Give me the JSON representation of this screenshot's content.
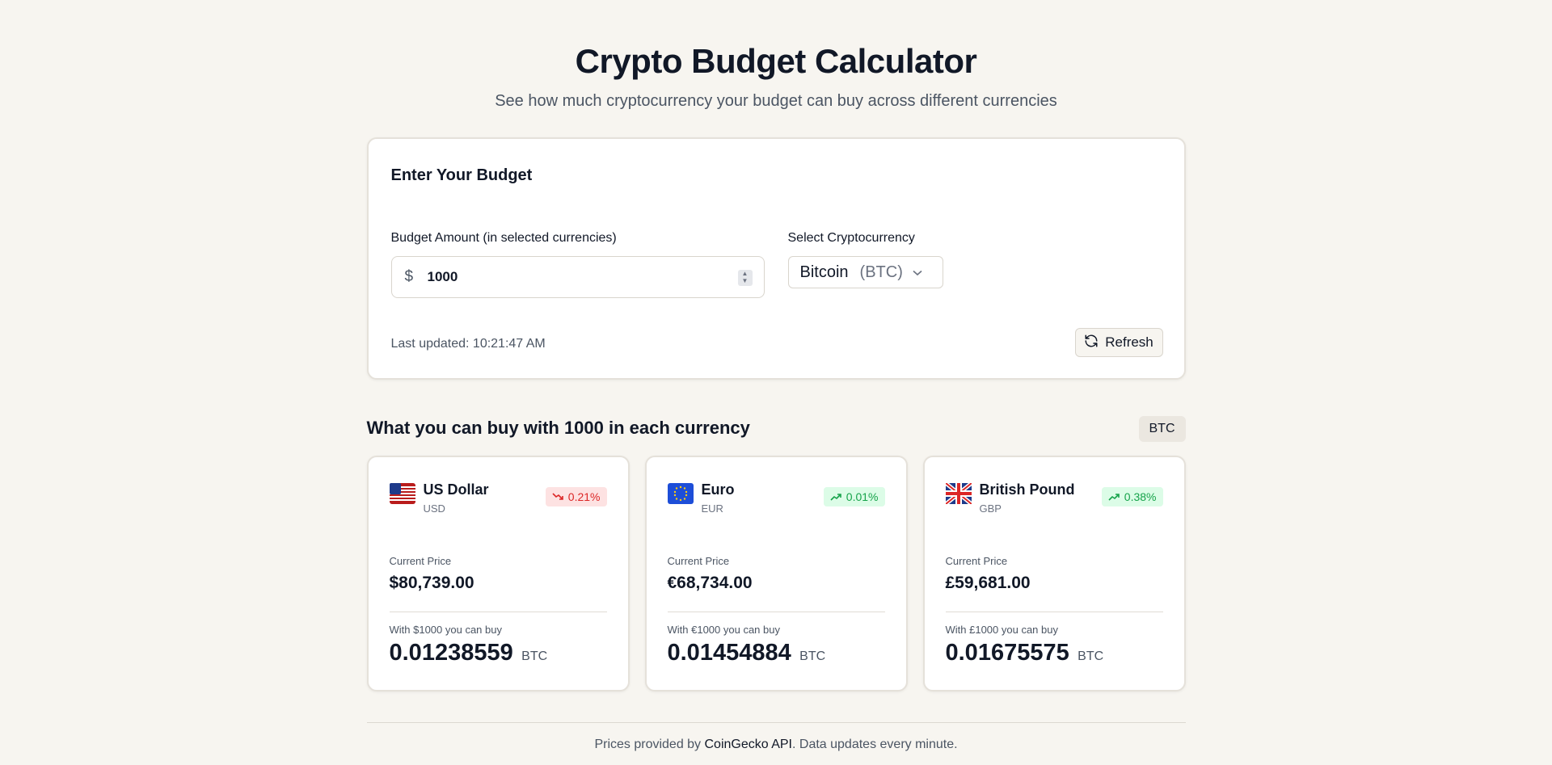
{
  "header": {
    "title": "Crypto Budget Calculator",
    "subtitle": "See how much cryptocurrency your budget can buy across different currencies"
  },
  "budget_form": {
    "heading": "Enter Your Budget",
    "amount_label": "Budget Amount (in selected currencies)",
    "currency_symbol": "$",
    "amount_value": "1000",
    "crypto_label": "Select Cryptocurrency",
    "crypto_selected_name": "Bitcoin",
    "crypto_selected_symbol": "(BTC)",
    "last_updated": "Last updated: 10:21:47 AM",
    "refresh_label": "Refresh"
  },
  "results": {
    "heading": "What you can buy with 1000 in each currency",
    "crypto_badge": "BTC",
    "cards": [
      {
        "flag": "us-flag-icon",
        "name": "US Dollar",
        "code": "USD",
        "change": "0.21%",
        "direction": "down",
        "price_label": "Current Price",
        "price": "$80,739.00",
        "buy_label": "With $1000 you can buy",
        "amount": "0.01238559",
        "unit": "BTC"
      },
      {
        "flag": "eu-flag-icon",
        "name": "Euro",
        "code": "EUR",
        "change": "0.01%",
        "direction": "up",
        "price_label": "Current Price",
        "price": "€68,734.00",
        "buy_label": "With €1000 you can buy",
        "amount": "0.01454884",
        "unit": "BTC"
      },
      {
        "flag": "uk-flag-icon",
        "name": "British Pound",
        "code": "GBP",
        "change": "0.38%",
        "direction": "up",
        "price_label": "Current Price",
        "price": "£59,681.00",
        "buy_label": "With £1000 you can buy",
        "amount": "0.01675575",
        "unit": "BTC"
      }
    ]
  },
  "footer": {
    "prefix": "Prices provided by ",
    "link": "CoinGecko API",
    "suffix": ". Data updates every minute."
  },
  "colors": {
    "background": "#f7f5f0",
    "negative": "#dc2626",
    "positive": "#16a34a"
  }
}
